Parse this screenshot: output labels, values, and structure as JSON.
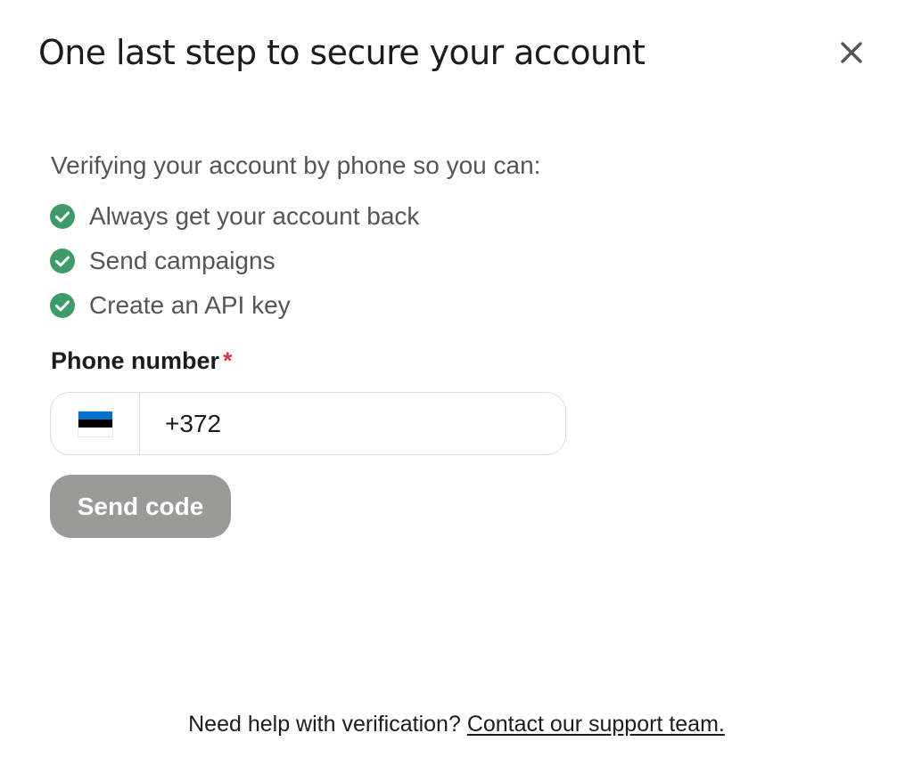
{
  "modal": {
    "title": "One last step to secure your account",
    "close_icon": "close-icon"
  },
  "intro": "Verifying your account by phone so you can:",
  "benefits": [
    {
      "icon": "check-circle-icon",
      "label": "Always get your account back"
    },
    {
      "icon": "check-circle-icon",
      "label": "Send campaigns"
    },
    {
      "icon": "check-circle-icon",
      "label": "Create an API key"
    }
  ],
  "phone": {
    "label": "Phone number",
    "required_mark": "*",
    "country_flag": "estonia-flag-icon",
    "value": "+372"
  },
  "send_button": {
    "label": "Send code",
    "state": "disabled"
  },
  "help": {
    "text": "Need help with verification?",
    "link_label": "Contact our support team."
  },
  "colors": {
    "check_green": "#3f9a6a",
    "required_red": "#dc3545",
    "button_disabled_bg": "#9a9a98",
    "flag_blue": "#0072ce",
    "flag_black": "#000000",
    "flag_white": "#ffffff"
  }
}
